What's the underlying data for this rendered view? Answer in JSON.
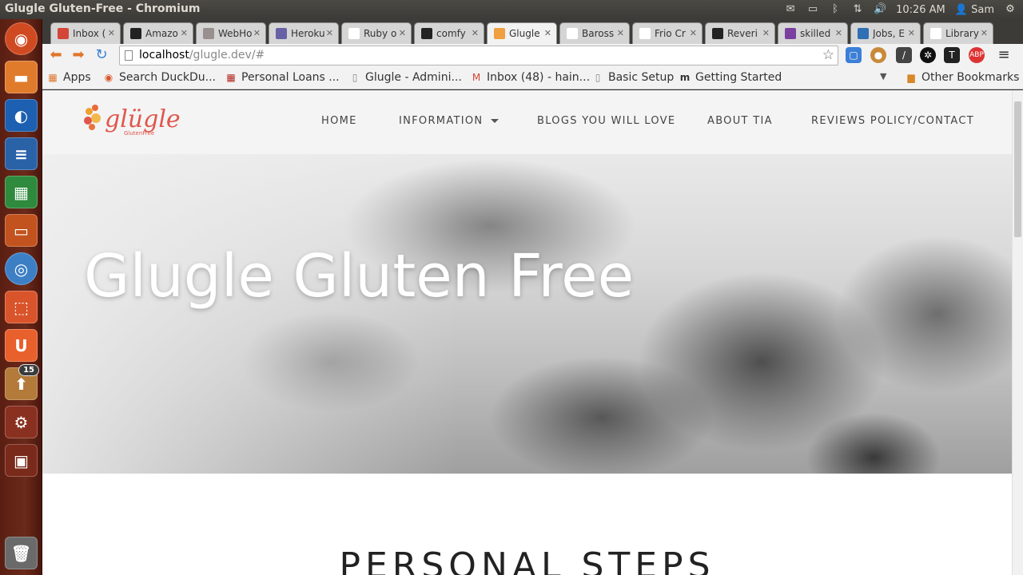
{
  "window": {
    "title": "Glugle Gluten-Free - Chromium"
  },
  "tray": {
    "time": "10:26 AM",
    "user": "Sam"
  },
  "launcher": {
    "badge_count": "15"
  },
  "tabs": [
    {
      "label": "Inbox (",
      "icon": "gmail-icon",
      "color": "#d44638"
    },
    {
      "label": "Amazo",
      "icon": "amazon-icon",
      "color": "#222222"
    },
    {
      "label": "WebHo",
      "icon": "loading-icon",
      "color": "#9a8f8f"
    },
    {
      "label": "Heroku",
      "icon": "heroku-icon",
      "color": "#6762a6"
    },
    {
      "label": "Ruby o",
      "icon": "page-icon",
      "color": "#ffffff"
    },
    {
      "label": "comfy",
      "icon": "github-icon",
      "color": "#222222"
    },
    {
      "label": "Glugle",
      "icon": "glugle-icon",
      "color": "#f0a040"
    },
    {
      "label": "Baross",
      "icon": "page-icon",
      "color": "#ffffff"
    },
    {
      "label": "Frio Cr",
      "icon": "page-icon",
      "color": "#ffffff"
    },
    {
      "label": "Reveri",
      "icon": "f-icon",
      "color": "#222222"
    },
    {
      "label": "skilled",
      "icon": "peace-icon",
      "color": "#7b3fa0"
    },
    {
      "label": "Jobs, E",
      "icon": "info-icon",
      "color": "#2f6fb4"
    },
    {
      "label": "Library",
      "icon": "page-icon",
      "color": "#ffffff"
    }
  ],
  "omnibox": {
    "host": "localhost",
    "path": "/glugle.dev/#"
  },
  "bookmarks": {
    "apps": "Apps",
    "items": [
      "Search DuckDu...",
      "Personal Loans ...",
      "Glugle - Admini...",
      "Inbox (48) - hain...",
      "Basic Setup",
      "Getting Started"
    ],
    "other": "Other Bookmarks"
  },
  "site": {
    "logo_text": "glügle",
    "logo_tag": "GlutenFree",
    "nav": [
      "HOME",
      "INFORMATION",
      "BLOGS YOU WILL LOVE",
      "ABOUT TIA",
      "REVIEWS POLICY/CONTACT"
    ],
    "hero_title": "Glugle Gluten Free",
    "section_title": "PERSONAL STEPS"
  }
}
